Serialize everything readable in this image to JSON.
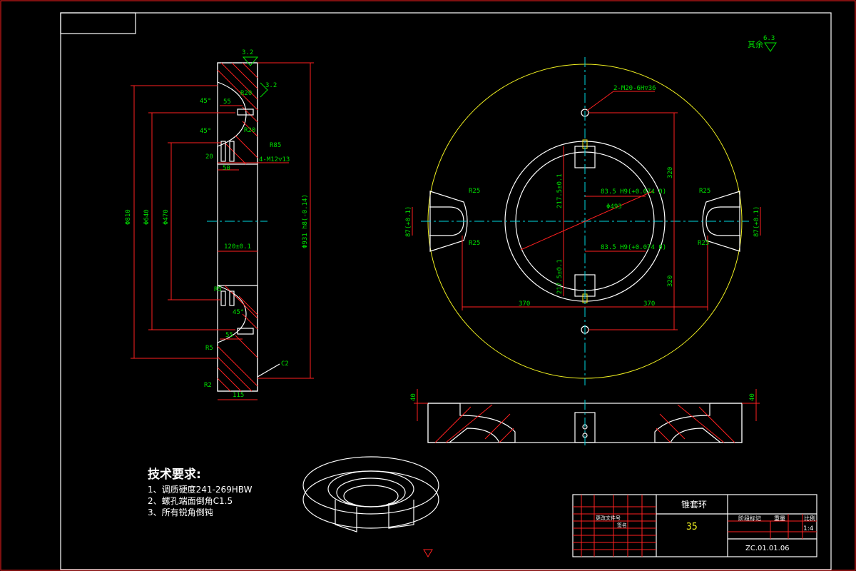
{
  "tech_requirements": {
    "title": "技术要求:",
    "items": [
      "1、调质硬度241-269HBW",
      "2、螺孔端面倒角C1.5",
      "3、所有锐角倒钝"
    ]
  },
  "roughness": {
    "other_label": "其余",
    "other_value": "6.3",
    "top_value": "3.2",
    "side_value": "3.2"
  },
  "section_view": {
    "dims": {
      "d810": "Φ810",
      "d640": "Φ640",
      "d470": "Φ470",
      "d931": "Φ931 h8(-0.14)",
      "w55a": "55",
      "w55b": "55",
      "w20": "20",
      "w50": "50",
      "w120": "120±0.1",
      "w115": "115",
      "r20a": "R20",
      "r20b": "R20",
      "r85": "R85",
      "r5a": "R5",
      "r5b": "R5",
      "r2": "R2",
      "a45a": "45°",
      "a45b": "45°",
      "a45c": "45°",
      "thread": "4-M12▽13",
      "c2": "C2"
    }
  },
  "top_view": {
    "dims": {
      "holes": "2-M20-6H▽36",
      "d493": "Φ493",
      "key_top": "83.5 H9(+0.074 0)",
      "key_bot": "83.5 H9(+0.074 0)",
      "h2175a": "217.5±0.1",
      "h2175b": "217.5±0.1",
      "r25a": "R25",
      "r25b": "R25",
      "r25c": "R25",
      "r25d": "R25",
      "v320a": "320",
      "v320b": "320",
      "h370a": "370",
      "h370b": "370",
      "s87a": "87(+0.1)",
      "s87b": "87(+0.1)"
    }
  },
  "front_view": {
    "dims": {
      "h40a": "40",
      "h40b": "40"
    }
  },
  "title_block": {
    "part_name": "锥套环",
    "material": "35",
    "drawing_no": "ZC.01.01.06",
    "scale": "1:4",
    "sheet_label": "阶段标记",
    "weight_label": "重量",
    "scale_label": "比例",
    "sign_label": "更改文件号",
    "date_label": "签名"
  }
}
